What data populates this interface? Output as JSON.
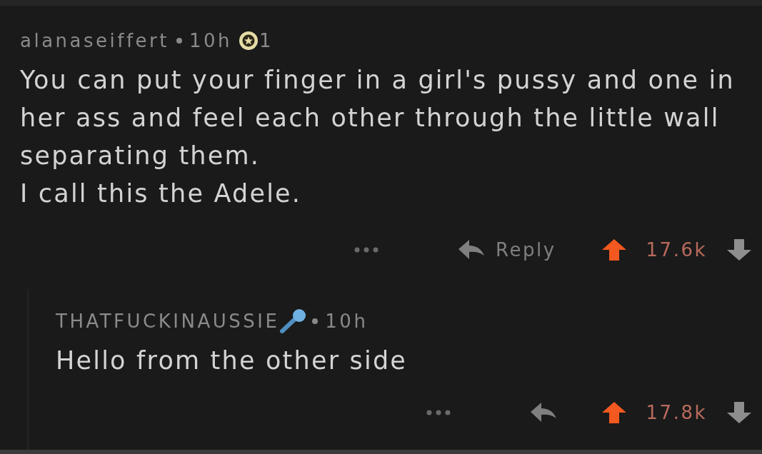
{
  "comments": [
    {
      "author": "alanaseiffert",
      "age": "10h",
      "flair_icon": false,
      "awards": "1",
      "body": [
        "You can put your finger in a girl's pussy and one in her ass and feel each other through the little wall separating them.",
        "I call this the Adele."
      ],
      "reply_label": "Reply",
      "score": "17.6k",
      "upvoted": true,
      "downvoted": false,
      "replies": [
        {
          "author": "THATFUCKINAUSSIE",
          "age": "10h",
          "flair_icon": true,
          "body": [
            "Hello from the other side"
          ],
          "score": "17.8k",
          "upvoted": true,
          "downvoted": false
        }
      ]
    }
  ]
}
